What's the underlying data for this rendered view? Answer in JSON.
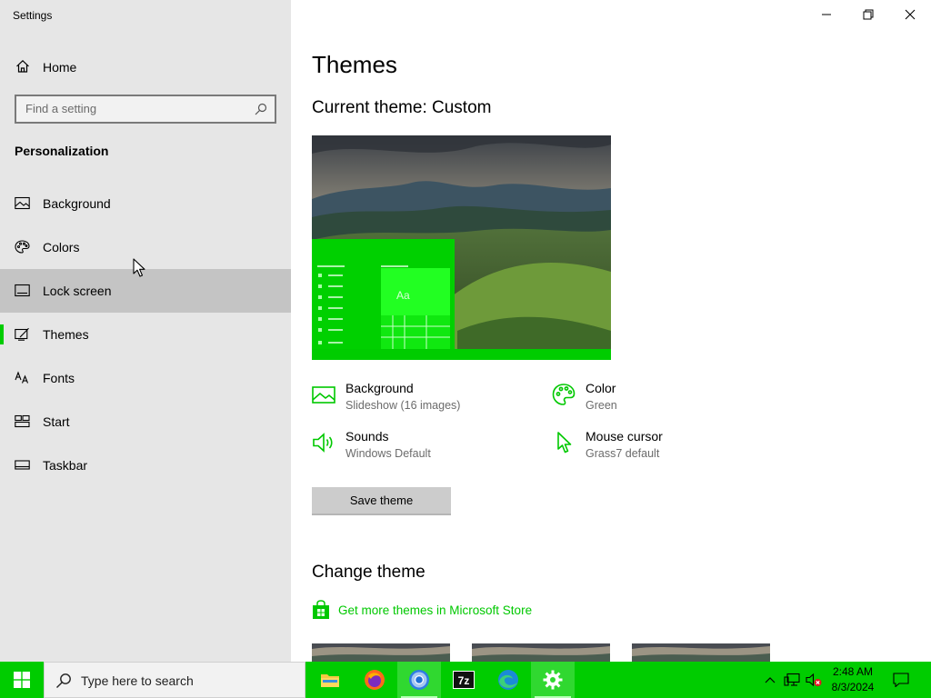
{
  "window": {
    "title": "Settings",
    "controls": {
      "minimize": "minimize-icon",
      "maximize": "restore-icon",
      "close": "close-icon"
    }
  },
  "sidebar": {
    "home_label": "Home",
    "search_placeholder": "Find a setting",
    "section_title": "Personalization",
    "items": [
      {
        "label": "Background",
        "icon": "picture-icon"
      },
      {
        "label": "Colors",
        "icon": "palette-icon"
      },
      {
        "label": "Lock screen",
        "icon": "lock-screen-icon"
      },
      {
        "label": "Themes",
        "icon": "themes-icon"
      },
      {
        "label": "Fonts",
        "icon": "fonts-icon"
      },
      {
        "label": "Start",
        "icon": "start-icon"
      },
      {
        "label": "Taskbar",
        "icon": "taskbar-icon"
      }
    ],
    "selected": "Themes",
    "hovered": "Lock screen"
  },
  "main": {
    "title": "Themes",
    "current_theme": "Current theme: Custom",
    "preview_sample_text": "Aa",
    "properties": [
      {
        "title": "Background",
        "value": "Slideshow (16 images)",
        "icon": "picture-icon"
      },
      {
        "title": "Color",
        "value": "Green",
        "icon": "palette-icon"
      },
      {
        "title": "Sounds",
        "value": "Windows Default",
        "icon": "speaker-icon"
      },
      {
        "title": "Mouse cursor",
        "value": "Grass7 default",
        "icon": "cursor-icon"
      }
    ],
    "save_button": "Save theme",
    "change_title": "Change theme",
    "store_link": "Get more themes in Microsoft Store"
  },
  "taskbar": {
    "search_placeholder": "Type here to search",
    "apps": [
      "file-explorer-icon",
      "firefox-icon",
      "chrome-icon",
      "7zip-icon",
      "edge-icon",
      "settings-gear-icon"
    ],
    "time": "2:48 AM",
    "date": "8/3/2024"
  },
  "colors": {
    "accent": "#00cc00",
    "sidebar_bg": "#e6e6e6",
    "hover_bg": "#c4c4c4"
  }
}
